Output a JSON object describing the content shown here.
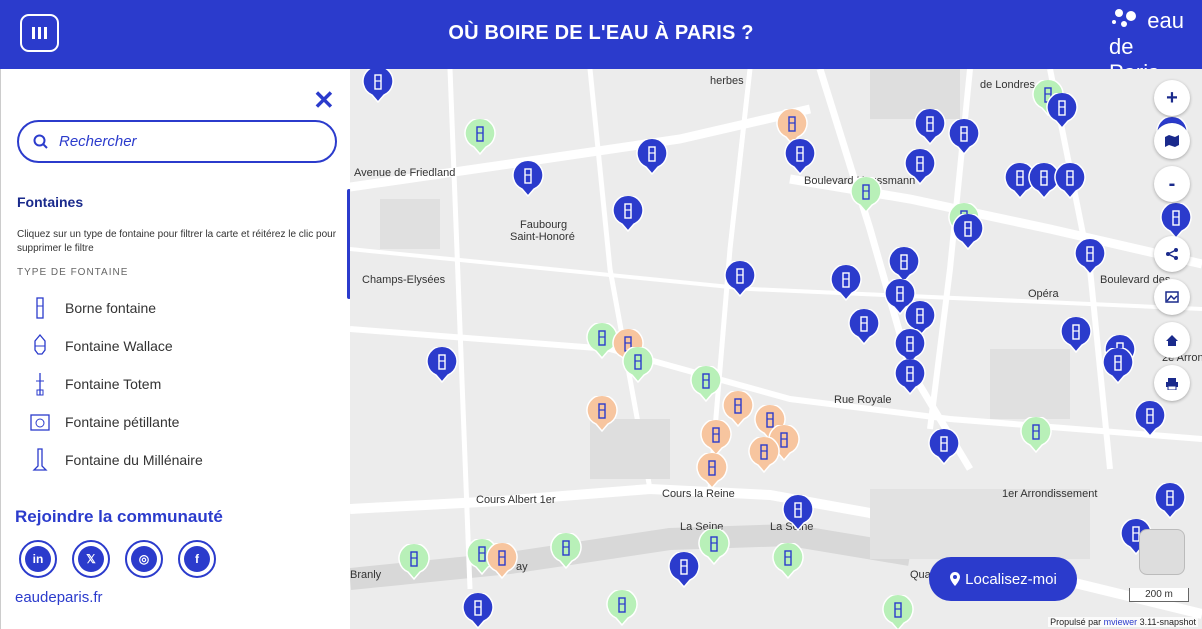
{
  "header": {
    "title": "OÙ BOIRE DE L'EAU À PARIS ?",
    "logo_line1": "eau",
    "logo_line2": "de Paris"
  },
  "search": {
    "placeholder": "Rechercher"
  },
  "filters": {
    "section_title": "Fontaines",
    "help_text": "Cliquez sur un type de fontaine pour filtrer la carte et réitérez le clic pour supprimer le filtre",
    "subtitle": "TYPE DE FONTAINE",
    "types": [
      {
        "label": "Borne fontaine",
        "icon": "borne-fontaine-icon"
      },
      {
        "label": "Fontaine Wallace",
        "icon": "fontaine-wallace-icon"
      },
      {
        "label": "Fontaine Totem",
        "icon": "fontaine-totem-icon"
      },
      {
        "label": "Fontaine pétillante",
        "icon": "fontaine-petillante-icon"
      },
      {
        "label": "Fontaine du Millénaire",
        "icon": "fontaine-millenaire-icon"
      }
    ]
  },
  "community": {
    "title": "Rejoindre la communauté",
    "socials": [
      "in",
      "𝕏",
      "◎",
      "f"
    ],
    "site": "eaudeparis.fr"
  },
  "map": {
    "labels": [
      "Avenue de Friedland",
      "Faubourg",
      "Saint-Honoré",
      "Champs-Elysées",
      "Opéra",
      "Cours Albert 1er",
      "Cours la Reine",
      "La Seine",
      "La Seine",
      "1er Arrondissement",
      "Rue Royale",
      "Boulevard Haussmann",
      "de Londres",
      "Boulevard des",
      "2e Arron",
      "Branly",
      "Quai",
      "ay",
      "herbes"
    ],
    "controls": {
      "zoom_in": "+",
      "zoom_out": "-"
    },
    "locate_label": "Localisez-moi",
    "scale": "200 m",
    "attribution_prefix": "Propulsé par ",
    "attribution_link": "mviewer",
    "attribution_version": " 3.11-snapshot"
  },
  "colors": {
    "primary": "#2b3bcc",
    "marker_blue": "#2b3bcc",
    "marker_green": "#b8f0b8",
    "marker_orange": "#f7c59f"
  }
}
